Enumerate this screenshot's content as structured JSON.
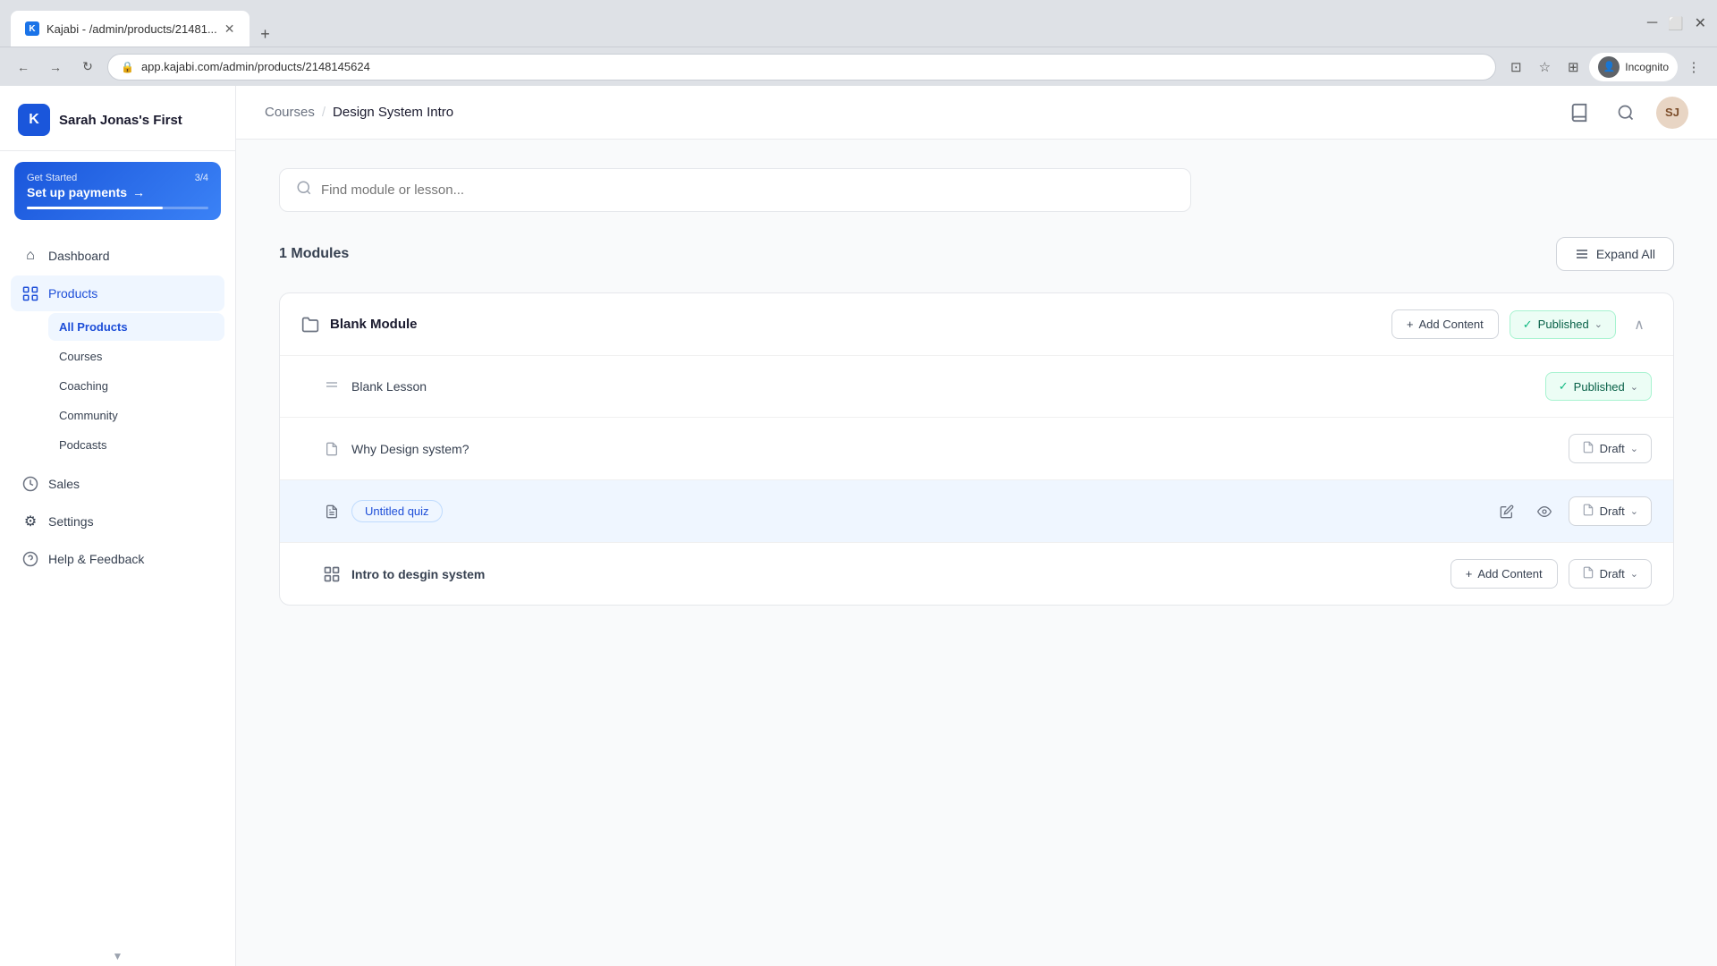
{
  "browser": {
    "tab_title": "Kajabi - /admin/products/21481...",
    "tab_favicon": "K",
    "url": "app.kajabi.com/admin/products/2148145624",
    "incognito_label": "Incognito"
  },
  "sidebar": {
    "brand_logo": "K",
    "brand_name": "Sarah Jonas's First",
    "get_started": {
      "label": "Get Started",
      "progress": "3/4",
      "title": "Set up payments",
      "arrow": "→"
    },
    "nav_items": [
      {
        "id": "dashboard",
        "label": "Dashboard",
        "icon": "⌂"
      },
      {
        "id": "products",
        "label": "Products",
        "icon": "◈"
      }
    ],
    "sub_nav_items": [
      {
        "id": "all-products",
        "label": "All Products",
        "active": true
      },
      {
        "id": "courses",
        "label": "Courses"
      },
      {
        "id": "coaching",
        "label": "Coaching"
      },
      {
        "id": "community",
        "label": "Community"
      },
      {
        "id": "podcasts",
        "label": "Podcasts"
      }
    ],
    "bottom_nav": [
      {
        "id": "sales",
        "label": "Sales",
        "icon": "◎"
      },
      {
        "id": "settings",
        "label": "Settings",
        "icon": "⚙"
      },
      {
        "id": "help",
        "label": "Help & Feedback",
        "icon": "?"
      }
    ]
  },
  "topbar": {
    "breadcrumb_courses": "Courses",
    "breadcrumb_sep": "/",
    "breadcrumb_current": "Design System Intro"
  },
  "content": {
    "search_placeholder": "Find module or lesson...",
    "modules_count_prefix": "1",
    "modules_count_label": "Modules",
    "expand_all_label": "Expand All",
    "module": {
      "title": "Blank Module",
      "add_content_label": "Add Content",
      "status_published": "Published",
      "lessons": [
        {
          "id": "blank-lesson",
          "title": "Blank Lesson",
          "status": "published",
          "status_label": "Published"
        },
        {
          "id": "why-design",
          "title": "Why Design system?",
          "status": "draft",
          "status_label": "Draft"
        },
        {
          "id": "untitled-quiz",
          "title": "Untitled quiz",
          "status": "draft",
          "status_label": "Draft",
          "is_quiz": true,
          "highlighted": true
        },
        {
          "id": "intro-design",
          "title": "Intro to desgin system",
          "status": "draft",
          "status_label": "Draft",
          "has_add_content": true,
          "add_content_label": "Add Content"
        }
      ]
    }
  },
  "icons": {
    "search": "🔍",
    "expand_all": "☰",
    "folder": "📁",
    "lesson": "≡",
    "document": "📄",
    "quiz": "📋",
    "sub_module": "⊞",
    "check": "✓",
    "chevron_down": "⌄",
    "chevron_up": "∧",
    "pencil": "✏",
    "eye": "👁",
    "plus": "+",
    "book": "📖",
    "magnify": "🔍",
    "arrow_right": "→"
  }
}
